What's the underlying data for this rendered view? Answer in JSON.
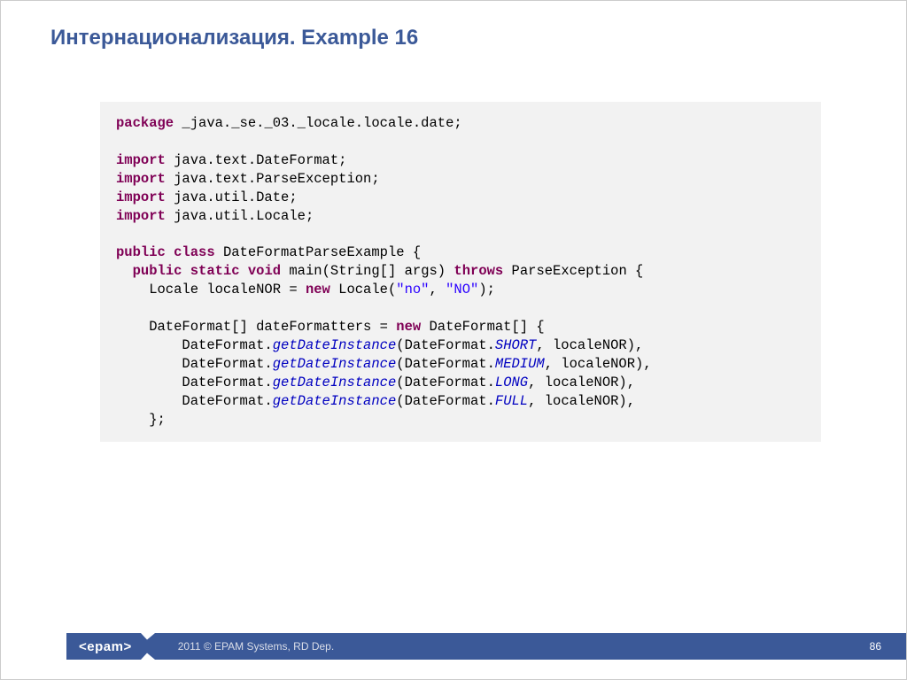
{
  "title": "Интернационализация. Example 16",
  "code": {
    "package_kw": "package",
    "package_val": " _java._se._03._locale.locale.date;",
    "import_kw": "import",
    "import1": " java.text.DateFormat;",
    "import2": " java.text.ParseException;",
    "import3": " java.util.Date;",
    "import4": " java.util.Locale;",
    "public_kw": "public",
    "class_kw": "class",
    "classname": " DateFormatParseExample {",
    "static_kw": "static",
    "void_kw": "void",
    "main_sig_a": " main(String[] args) ",
    "throws_kw": "throws",
    "main_sig_b": " ParseException {",
    "locale_line_a": "    Locale localeNOR = ",
    "new_kw": "new",
    "locale_line_b": " Locale(",
    "str_no": "\"no\"",
    "comma": ", ",
    "str_NO": "\"NO\"",
    "locale_line_c": ");",
    "df_line_a": "    DateFormat[] dateFormatters = ",
    "df_line_b": " DateFormat[] {",
    "getdate_pre": "        DateFormat.",
    "getdate_call": "getDateInstance",
    "getdate_mid": "(DateFormat.",
    "const_short": "SHORT",
    "const_medium": "MEDIUM",
    "const_long": "LONG",
    "const_full": "FULL",
    "getdate_suf": ", localeNOR),",
    "close_arr": "    };",
    "indent_main": "  "
  },
  "footer": {
    "logo": "<epam>",
    "copyright": "2011 © EPAM Systems, RD Dep.",
    "page": "86"
  }
}
